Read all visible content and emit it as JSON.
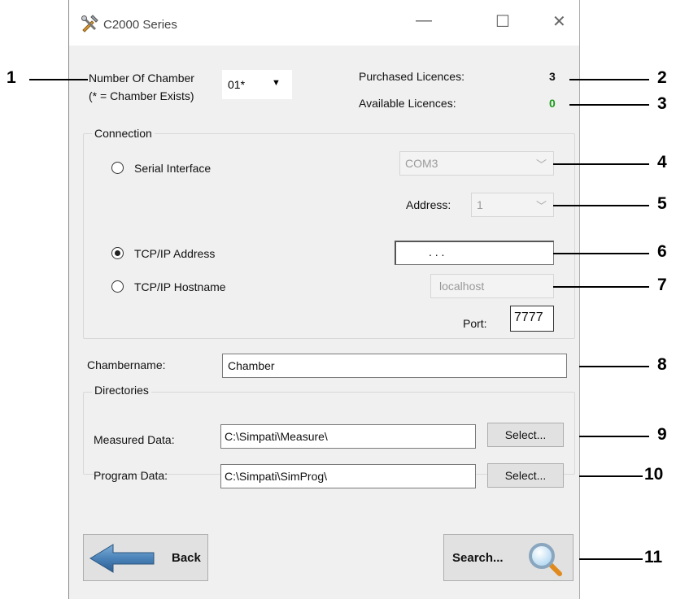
{
  "window": {
    "title": "C2000 Series",
    "app_icon": "tools-icon",
    "controls": {
      "minimize": "—",
      "maximize": "☐",
      "close": "✕"
    }
  },
  "chamber_selector": {
    "label_line1": "Number Of Chamber",
    "label_line2": "(* = Chamber Exists)",
    "selected": "01*"
  },
  "licences": {
    "purchased_label": "Purchased Licences:",
    "purchased_value": "3",
    "available_label": "Available Licences:",
    "available_value": "0",
    "available_color": "#1e9a1e"
  },
  "connection": {
    "title": "Connection",
    "serial_label": "Serial Interface",
    "serial_port": "COM3",
    "address_label": "Address:",
    "address_value": "1",
    "tcp_address_label": "TCP/IP Address",
    "tcp_address_value": ".       .       .",
    "tcp_hostname_label": "TCP/IP Hostname",
    "hostname_value": "localhost",
    "port_label": "Port:",
    "port_value": "7777",
    "selected_mode": "TCP/IP Address"
  },
  "chambername": {
    "label": "Chambername:",
    "value": "Chamber"
  },
  "directories": {
    "title": "Directories",
    "measured_label": "Measured Data:",
    "measured_value": "C:\\Simpati\\Measure\\",
    "program_label": "Program Data:",
    "program_value": "C:\\Simpati\\SimProg\\",
    "select_label": "Select..."
  },
  "footer": {
    "back_label": "Back",
    "search_label": "Search..."
  },
  "callouts": [
    "1",
    "2",
    "3",
    "4",
    "5",
    "6",
    "7",
    "8",
    "9",
    "10",
    "11"
  ]
}
